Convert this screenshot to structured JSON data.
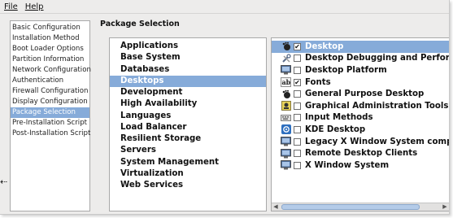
{
  "menubar": {
    "file": "File",
    "help": "Help"
  },
  "steps": [
    "Basic Configuration",
    "Installation Method",
    "Boot Loader Options",
    "Partition Information",
    "Network Configuration",
    "Authentication",
    "Firewall Configuration",
    "Display Configuration",
    "Package Selection",
    "Pre-Installation Script",
    "Post-Installation Script"
  ],
  "selected_step": "Package Selection",
  "section_title": "Package Selection",
  "groups": [
    "Applications",
    "Base System",
    "Databases",
    "Desktops",
    "Development",
    "High Availability",
    "Languages",
    "Load Balancer",
    "Resilient Storage",
    "Servers",
    "System Management",
    "Virtualization",
    "Web Services"
  ],
  "selected_group": "Desktops",
  "packages": [
    {
      "label": "Desktop",
      "checked": true,
      "icon": "gnome-foot-icon"
    },
    {
      "label": "Desktop Debugging and Performance",
      "checked": false,
      "icon": "tools-icon"
    },
    {
      "label": "Desktop Platform",
      "checked": false,
      "icon": "monitor-icon"
    },
    {
      "label": "Fonts",
      "checked": true,
      "icon": "font-icon"
    },
    {
      "label": "General Purpose Desktop",
      "checked": false,
      "icon": "gnome-foot-icon"
    },
    {
      "label": "Graphical Administration Tools",
      "checked": false,
      "icon": "admin-tools-icon"
    },
    {
      "label": "Input Methods",
      "checked": false,
      "icon": "keyboard-icon"
    },
    {
      "label": "KDE Desktop",
      "checked": false,
      "icon": "kde-icon"
    },
    {
      "label": "Legacy X Window System compatibility",
      "checked": false,
      "icon": "monitor-icon"
    },
    {
      "label": "Remote Desktop Clients",
      "checked": false,
      "icon": "monitor-icon"
    },
    {
      "label": "X Window System",
      "checked": false,
      "icon": "monitor-icon"
    }
  ],
  "selected_package": "Desktop",
  "colors": {
    "selection": "#86abd9",
    "window_bg": "#edeceb",
    "border": "#a9a9a9"
  }
}
